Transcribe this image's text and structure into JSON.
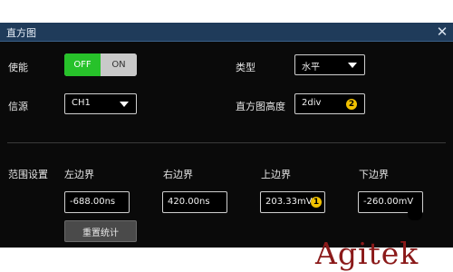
{
  "window": {
    "title": "直方图",
    "close_icon": "close-icon"
  },
  "row1": {
    "enable_label": "使能",
    "toggle": {
      "off_label": "OFF",
      "on_label": "ON",
      "state": "OFF"
    },
    "type_label": "类型",
    "type_value": "水平"
  },
  "row2": {
    "source_label": "信源",
    "source_value": "CH1",
    "height_label": "直方图高度",
    "height_value": "2div",
    "height_knob": "2"
  },
  "range": {
    "label": "范围设置",
    "left_label": "左边界",
    "left_value": "-688.00ns",
    "right_label": "右边界",
    "right_value": "420.00ns",
    "top_label": "上边界",
    "top_value": "203.33mV",
    "top_knob": "1",
    "bottom_label": "下边界",
    "bottom_value": "-260.00mV",
    "reset_label": "重置统计"
  },
  "branding": {
    "logo_text": "Agitek"
  },
  "colors": {
    "toggle_active": "#27c22a",
    "titlebar": "#1f3b5a",
    "knob": "#f2c200",
    "logo": "#8b1a1a"
  }
}
